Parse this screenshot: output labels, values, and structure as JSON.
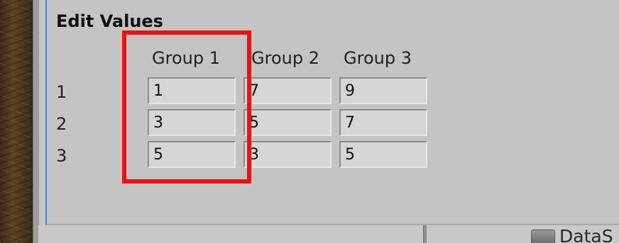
{
  "dialog": {
    "title": "Edit Values",
    "columns": [
      "Group 1",
      "Group 2",
      "Group 3"
    ],
    "rows": [
      {
        "label": "1",
        "values": [
          "1",
          "7",
          "9"
        ]
      },
      {
        "label": "2",
        "values": [
          "3",
          "5",
          "7"
        ]
      },
      {
        "label": "3",
        "values": [
          "5",
          "3",
          "5"
        ]
      }
    ]
  },
  "background": {
    "data_item_label": "DataS"
  },
  "colors": {
    "highlight": "#ee1111",
    "dialog_accent": "#4f86c6"
  },
  "icons": [
    "folder-icon"
  ]
}
